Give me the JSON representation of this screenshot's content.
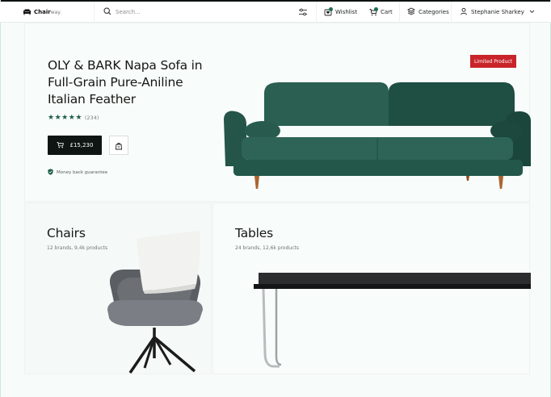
{
  "header": {
    "logo_brand": "Chair",
    "logo_suffix": "way.",
    "search_placeholder": "Search...",
    "wishlist_label": "Wishlist",
    "cart_label": "Cart",
    "categories_label": "Categories",
    "user_name": "Stephanie Sharkey",
    "icons": [
      "sofa-logo-icon",
      "search-icon",
      "filter-icon",
      "wishlist-icon",
      "cart-icon",
      "layers-icon",
      "user-icon",
      "chevron-down-icon"
    ]
  },
  "hero": {
    "title": "OLY & BARK Napa Sofa in Full-Grain Pure-Aniline Italian Feather",
    "rating_stars": 5,
    "rating_count": "(234)",
    "price": "£15,230",
    "guarantee": "Money back guarantee",
    "badge": "Limited Product"
  },
  "categories": [
    {
      "title": "Chairs",
      "subtitle": "12 brands, 9,4k products"
    },
    {
      "title": "Tables",
      "subtitle": "24 brands, 12,6k products"
    }
  ],
  "colors": {
    "accent": "#1f5e4b",
    "badge": "#c8242a",
    "dark": "#0f1513",
    "sofa": "#1d4f45"
  }
}
